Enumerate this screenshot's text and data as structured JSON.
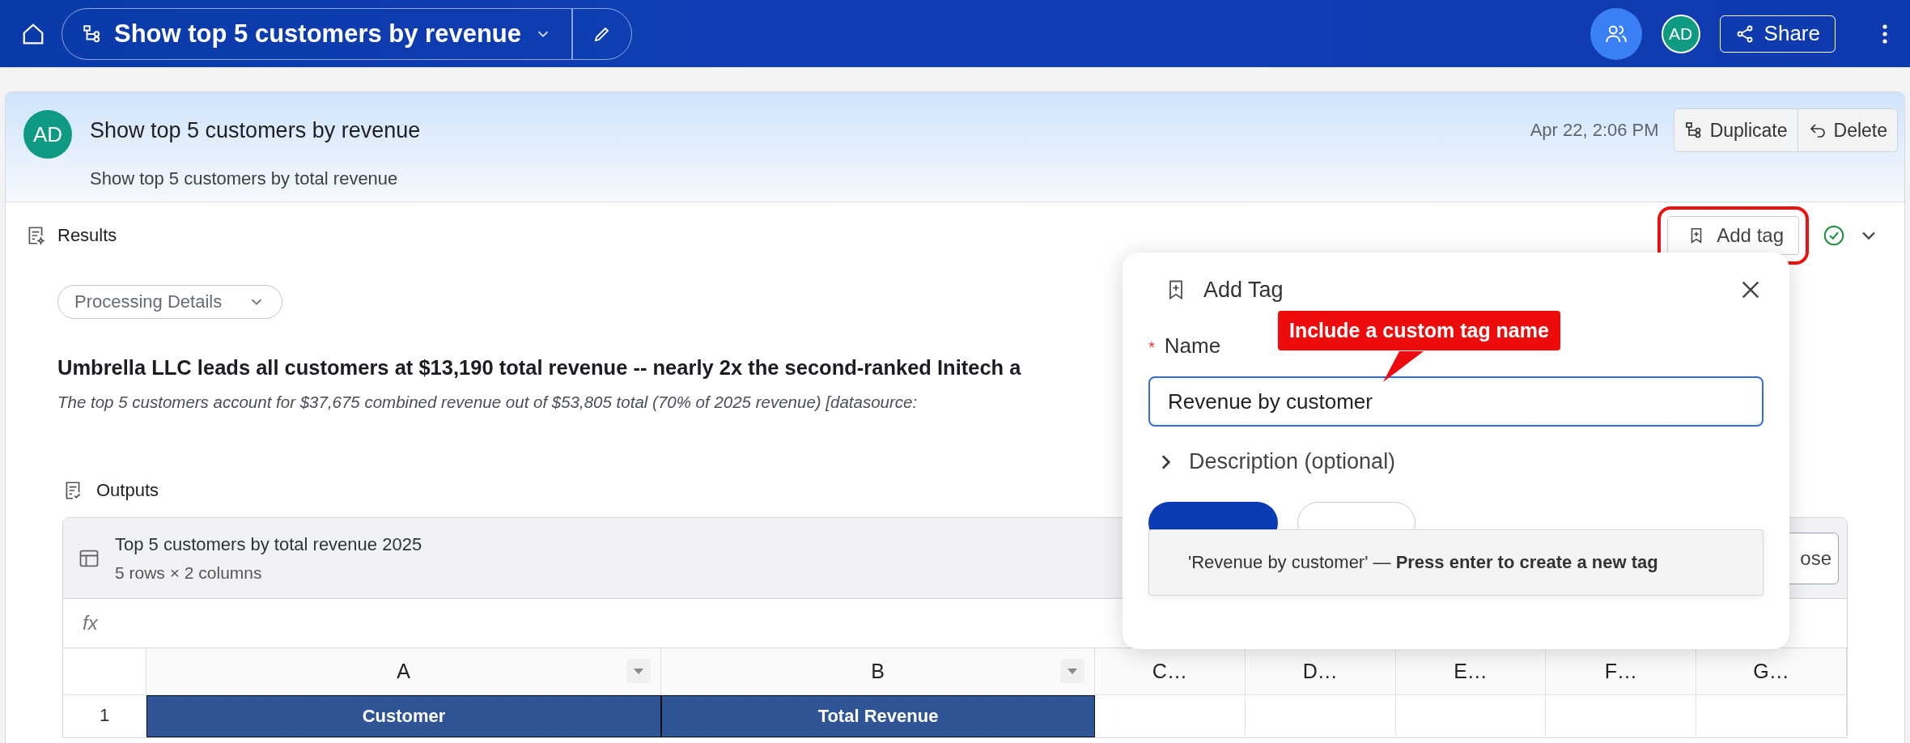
{
  "topbar": {
    "title": "Show top 5 customers by revenue",
    "avatar": "AD",
    "share": "Share"
  },
  "thread": {
    "avatar": "AD",
    "title": "Show top 5 customers by revenue",
    "subtitle": "Show top 5 customers by total revenue",
    "date": "Apr 22, 2:06 PM",
    "actions": [
      {
        "kind": "duplicate",
        "label": "Duplicate"
      },
      {
        "kind": "delete",
        "label": "Delete"
      }
    ]
  },
  "results": {
    "label": "Results",
    "add_tag": {
      "label": "Add tag",
      "highlighted": true
    },
    "complete": true,
    "processing": "Processing Details",
    "headline": "Umbrella LLC leads all customers at $13,190 total revenue -- nearly 2x the second-ranked Initech a",
    "summary": "The top 5 customers account for $37,675 combined revenue out of $53,805 total (70% of 2025 revenue) [datasource:"
  },
  "outputs": {
    "label": "Outputs",
    "table": {
      "title": "Top 5 customers by total revenue 2025",
      "subtitle": "5 rows × 2 columns",
      "close": "ose",
      "formula": "fx",
      "columns": [
        {
          "label": "A",
          "filter": true
        },
        {
          "label": "B",
          "filter": true
        },
        {
          "label": "C…",
          "filter": false
        },
        {
          "label": "D…",
          "filter": false
        },
        {
          "label": "E…",
          "filter": false
        },
        {
          "label": "F…",
          "filter": false
        },
        {
          "label": "G…",
          "filter": false
        }
      ],
      "rows": [
        {
          "number": "1",
          "cells": [
            "Customer",
            "Total Revenue",
            "",
            "",
            "",
            "",
            ""
          ]
        }
      ]
    }
  },
  "popup": {
    "title": "Add Tag",
    "name_label": "Name",
    "required_mark": "*",
    "value": "Revenue by customer",
    "description": "Description (optional)",
    "expanded": false,
    "suggestion": "'Revenue by customer' — **Press enter to create a new tag**"
  },
  "callout": "Include a custom tag name"
}
